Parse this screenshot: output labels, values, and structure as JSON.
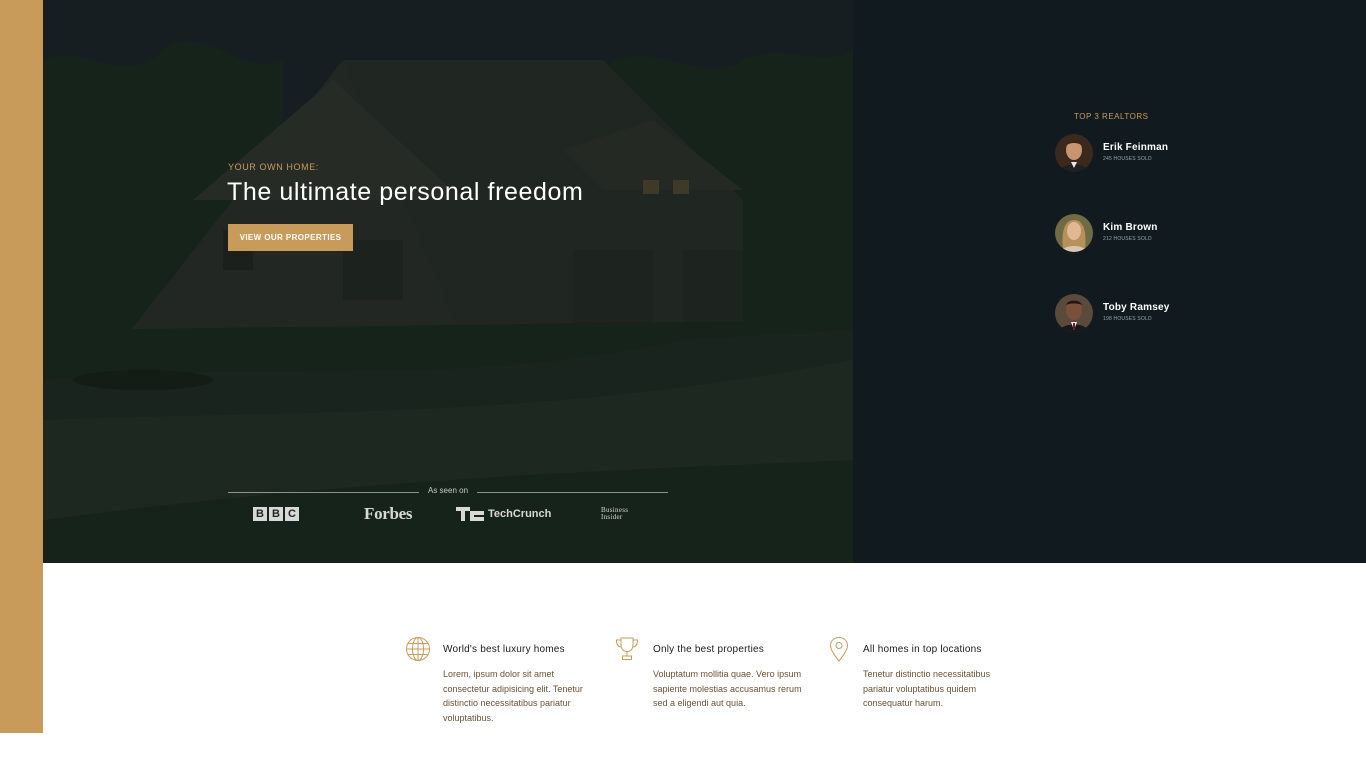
{
  "colors": {
    "accent": "#c89b5b",
    "hero_dark": "#1b2126",
    "panel_dark": "#111b1f",
    "feature_text": "#6a5236"
  },
  "hero": {
    "eyebrow": "YOUR OWN HOME:",
    "title": "The ultimate personal freedom",
    "cta_label": "VIEW OUR PROPERTIES",
    "seen_on_label": "As seen on",
    "logos": [
      {
        "name": "BBC",
        "icon": "bbc-logo",
        "letters": [
          "B",
          "B",
          "C"
        ]
      },
      {
        "name": "Forbes",
        "icon": "forbes-logo"
      },
      {
        "name": "TechCrunch",
        "icon": "techcrunch-logo"
      },
      {
        "name": "Business Insider",
        "icon": "business-insider-logo",
        "line1": "Business",
        "line2": "Insider"
      }
    ]
  },
  "realtors": {
    "heading": "TOP 3 REALTORS",
    "items": [
      {
        "name": "Erik Feinman",
        "sold": "245 HOUSES SOLD",
        "icon": "avatar-photo"
      },
      {
        "name": "Kim Brown",
        "sold": "212 HOUSES SOLD",
        "icon": "avatar-photo"
      },
      {
        "name": "Toby Ramsey",
        "sold": "198 HOUSES SOLD",
        "icon": "avatar-photo"
      }
    ]
  },
  "features": [
    {
      "icon": "globe-icon",
      "title": "World's best luxury homes",
      "body": "Lorem, ipsum dolor sit amet consectetur adipisicing elit. Tenetur distinctio necessitatibus pariatur voluptatibus."
    },
    {
      "icon": "trophy-icon",
      "title": "Only the best properties",
      "body": "Voluptatum mollitia quae. Vero ipsum sapiente molestias accusamus rerum sed a eligendi aut quia."
    },
    {
      "icon": "map-pin-icon",
      "title": "All homes in top locations",
      "body": "Tenetur distinctio necessitatibus pariatur voluptatibus quidem consequatur harum."
    }
  ]
}
